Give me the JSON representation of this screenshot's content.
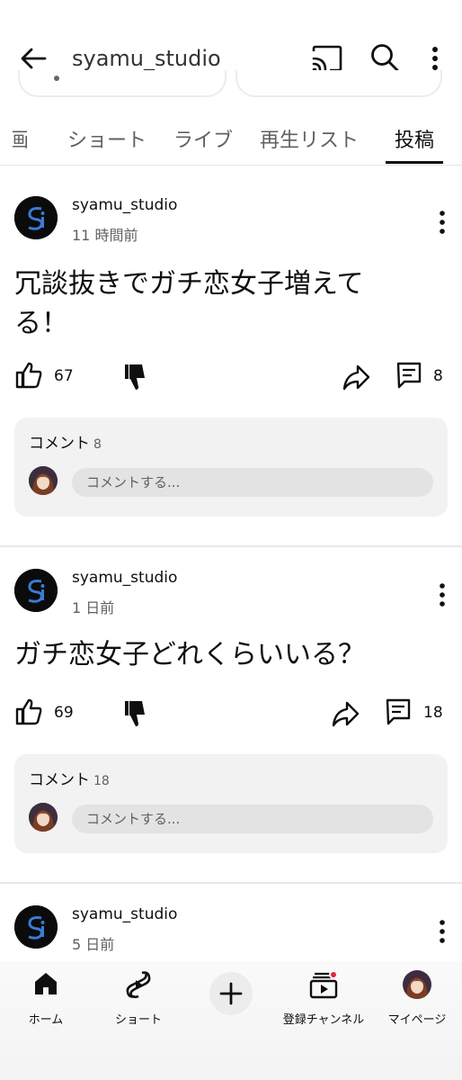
{
  "header": {
    "channel_name": "syamu_studio",
    "back_icon": "arrow-left-icon",
    "cast_icon": "cast-icon",
    "search_icon": "search-icon",
    "more_icon": "more-vert-icon"
  },
  "tabs": [
    {
      "label": "画"
    },
    {
      "label": "ショート"
    },
    {
      "label": "ライブ"
    },
    {
      "label": "再生リスト"
    },
    {
      "label": "投稿"
    }
  ],
  "active_tab": "投稿",
  "posts": [
    {
      "author": "syamu_studio",
      "time": "11 時間前",
      "text": "冗談抜きでガチ恋女子増えてる！",
      "likes": "67",
      "comments": "8",
      "comment_label": "コメント",
      "comment_count": "8",
      "comment_placeholder": "コメントする..."
    },
    {
      "author": "syamu_studio",
      "time": "1 日前",
      "text": "ガチ恋女子どれくらいいる？",
      "likes": "69",
      "comments": "18",
      "comment_label": "コメント",
      "comment_count": "18",
      "comment_placeholder": "コメントする..."
    },
    {
      "author": "syamu_studio",
      "time": "5 日前"
    }
  ],
  "bottom_nav": [
    {
      "label": "ホーム",
      "icon": "home-icon"
    },
    {
      "label": "ショート",
      "icon": "shorts-icon"
    },
    {
      "label": "",
      "icon": "plus-icon"
    },
    {
      "label": "登録チャンネル",
      "icon": "subscriptions-icon"
    },
    {
      "label": "マイページ",
      "icon": "profile-avatar-icon"
    }
  ],
  "colors": {
    "text": "#0f0f0f",
    "secondary": "#606060",
    "card_bg": "#f2f2f2",
    "badge": "#e0263a"
  }
}
